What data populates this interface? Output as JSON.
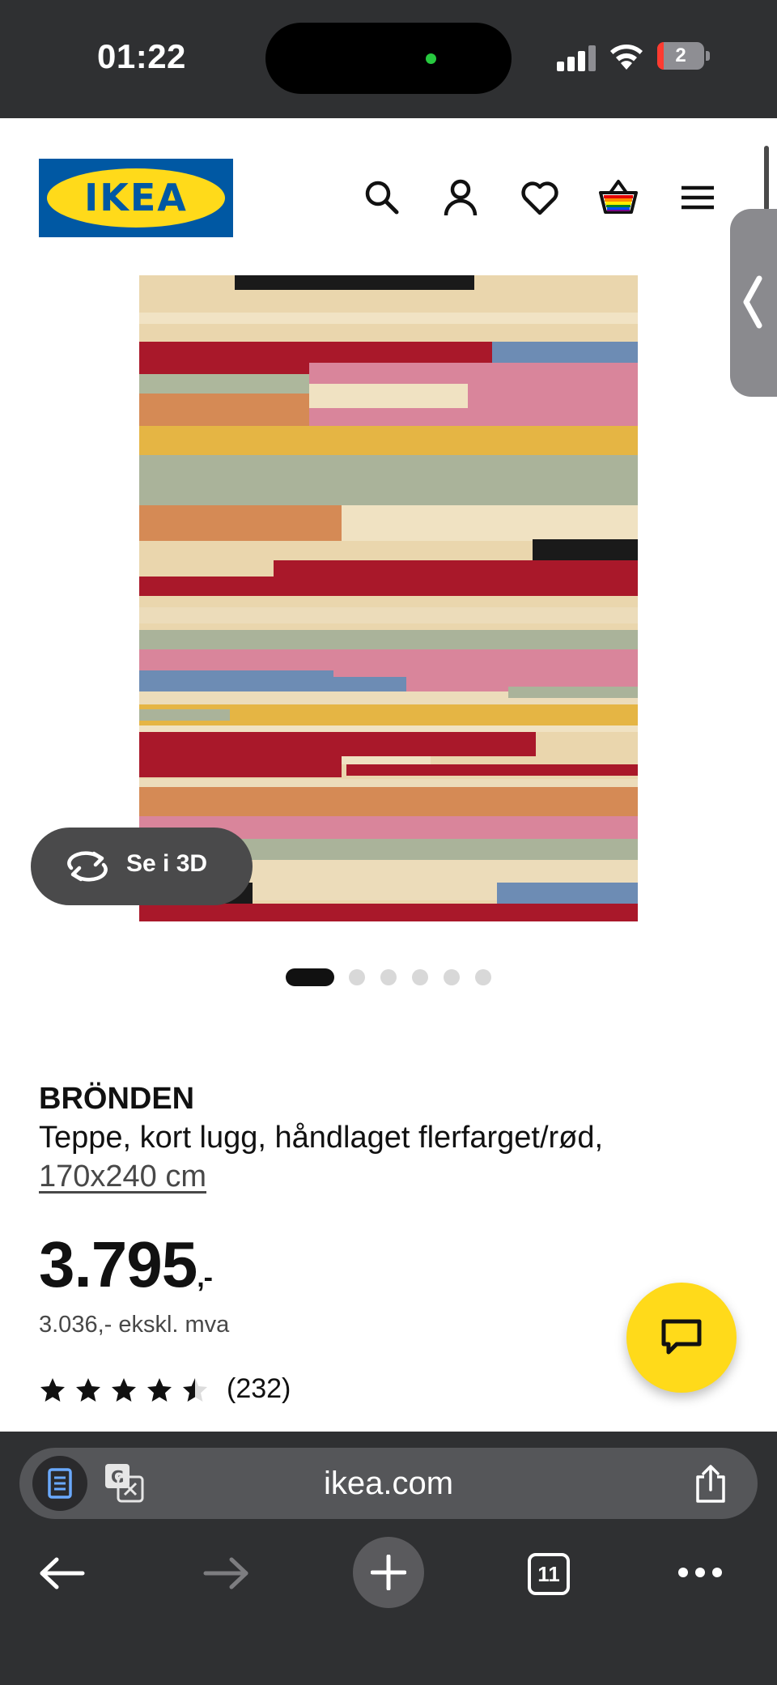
{
  "status_bar": {
    "time": "01:22",
    "battery": "2"
  },
  "header": {
    "logo_text": "IKEA",
    "logo_colors": {
      "blue": "#0058a3",
      "yellow": "#ffda1a"
    }
  },
  "gallery": {
    "view_3d_label": "Se i 3D",
    "image_count": 6,
    "active_index": 0
  },
  "product": {
    "brand": "BRÖNDEN",
    "description": "Teppe, kort lugg, håndlaget flerfarget/rød,",
    "size": "170x240 cm",
    "price": "3.795",
    "price_suffix": ",-",
    "price_ex_vat": "3.036,- ekskl. mva",
    "rating": 4.5,
    "reviews": "(232)"
  },
  "browser": {
    "url": "ikea.com",
    "tab_count": "11"
  },
  "icons": [
    "search-icon",
    "account-icon",
    "heart-icon",
    "basket-icon",
    "menu-icon",
    "chevron-left-icon",
    "rotate-3d-icon",
    "chat-icon",
    "reader-icon",
    "translate-icon",
    "share-icon",
    "back-arrow-icon",
    "forward-arrow-icon",
    "plus-icon",
    "tabs-icon",
    "more-icon"
  ]
}
